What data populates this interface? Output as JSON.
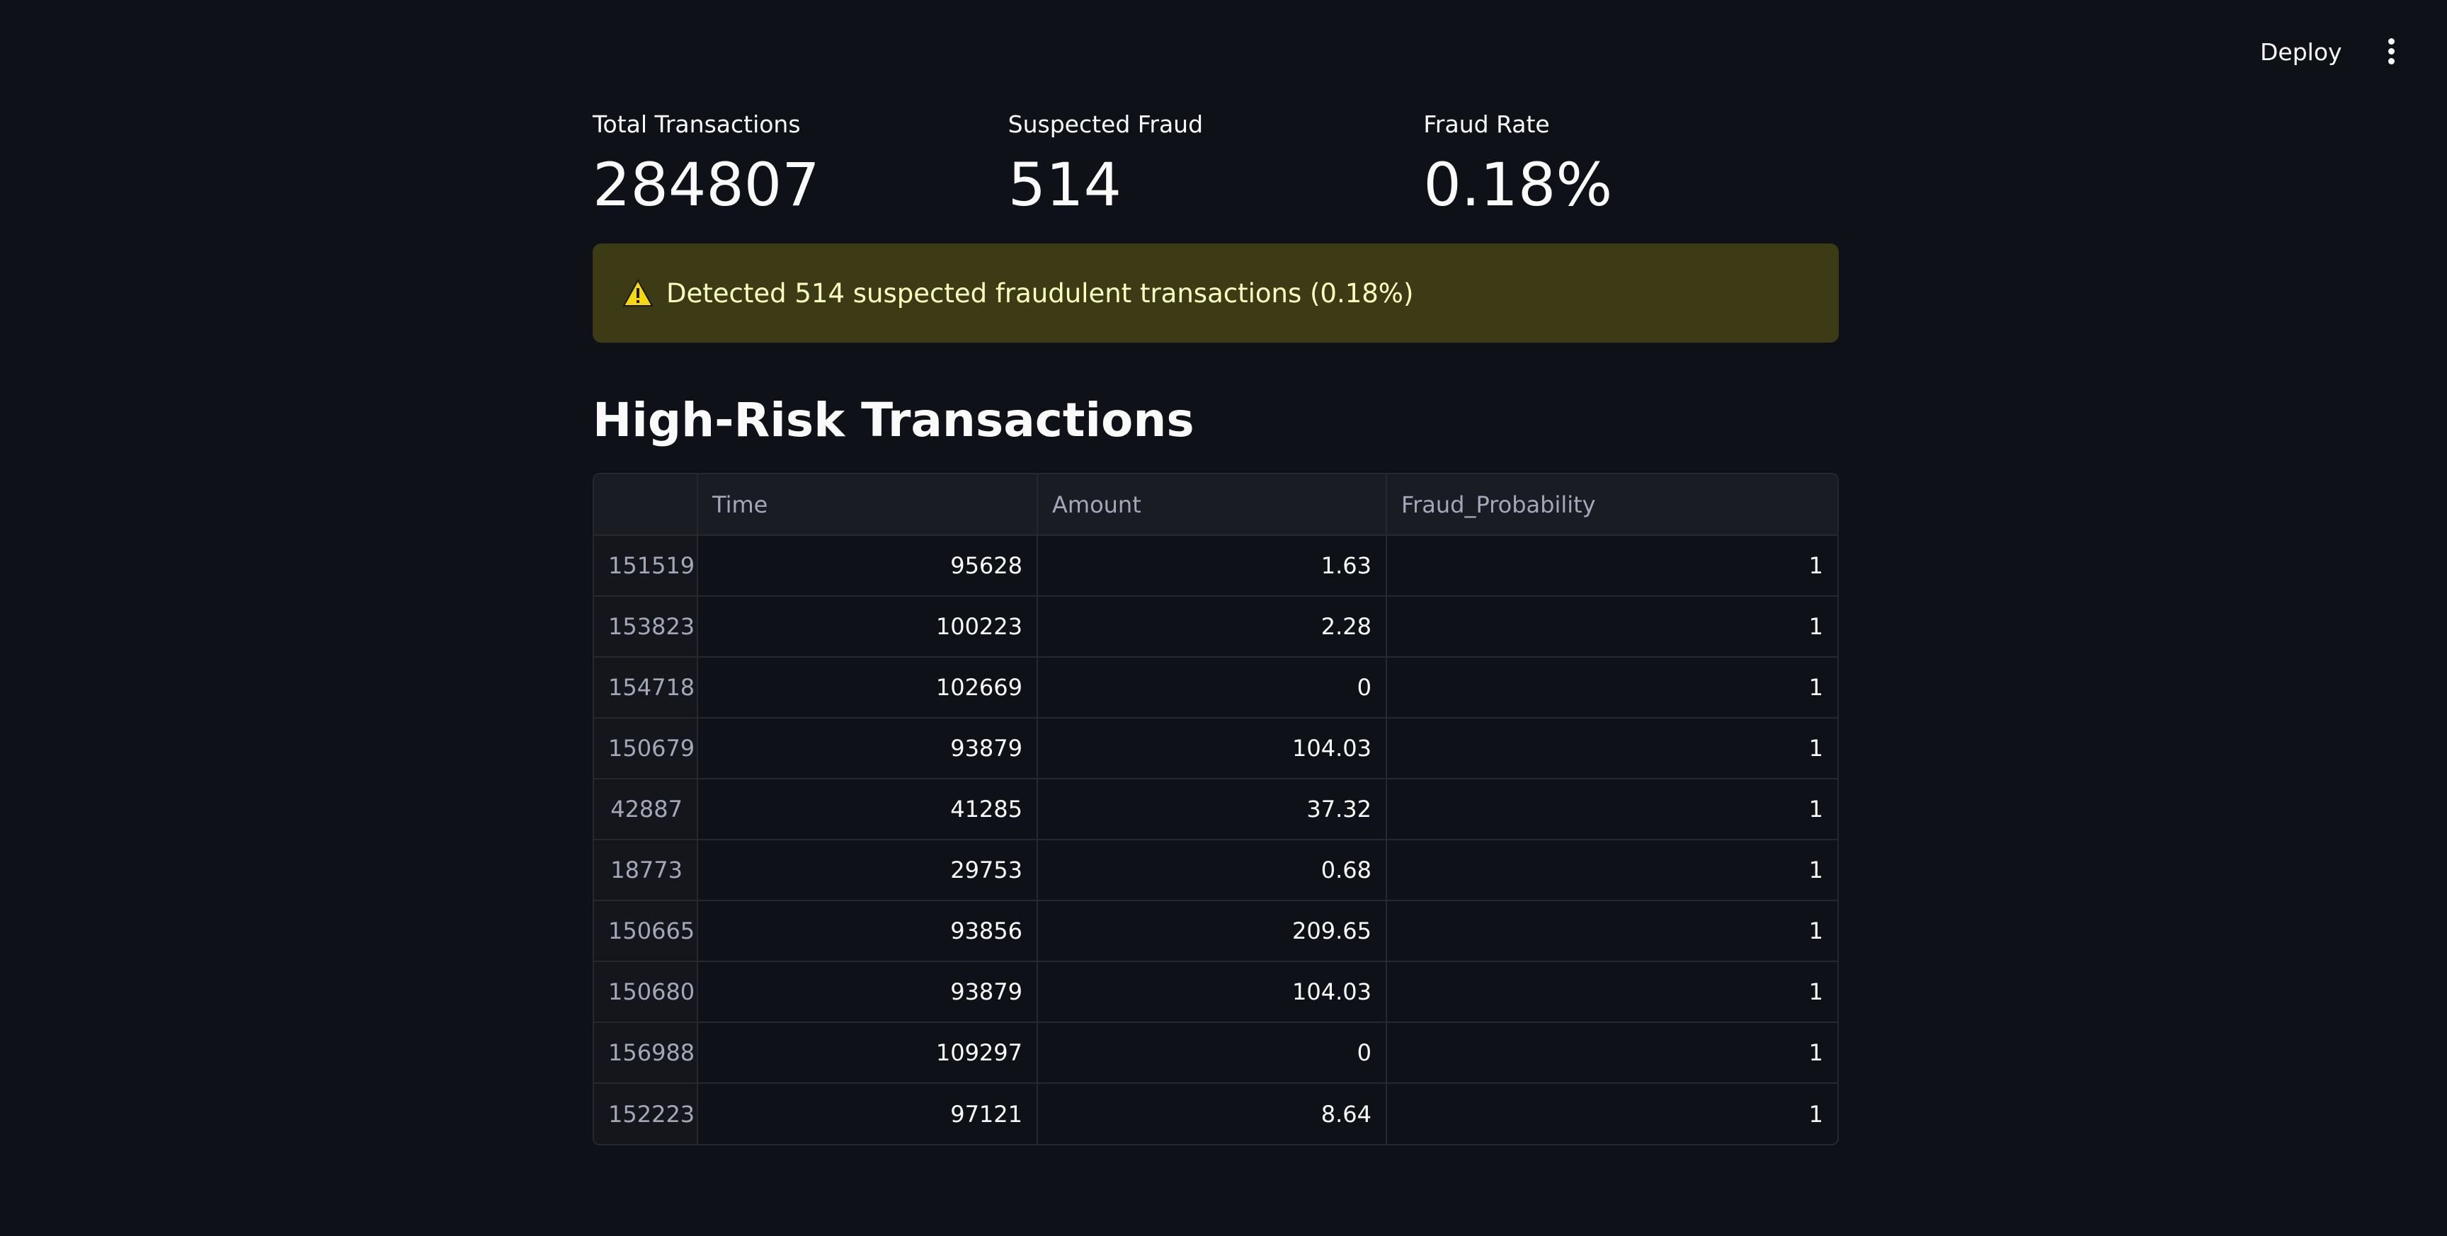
{
  "header": {
    "deploy_label": "Deploy",
    "menu_icon": "more-vertical-icon"
  },
  "metrics": [
    {
      "label": "Total Transactions",
      "value": "284807"
    },
    {
      "label": "Suspected Fraud",
      "value": "514"
    },
    {
      "label": "Fraud Rate",
      "value": "0.18%"
    }
  ],
  "alert": {
    "icon": "warning-icon",
    "text": "Detected 514 suspected fraudulent transactions (0.18%)",
    "background": "#3d3a16",
    "text_color": "#ffffc2"
  },
  "section": {
    "title": "High-Risk Transactions"
  },
  "table": {
    "columns": [
      "",
      "Time",
      "Amount",
      "Fraud_Probability"
    ],
    "rows": [
      [
        "151519",
        "95628",
        "1.63",
        "1"
      ],
      [
        "153823",
        "100223",
        "2.28",
        "1"
      ],
      [
        "154718",
        "102669",
        "0",
        "1"
      ],
      [
        "150679",
        "93879",
        "104.03",
        "1"
      ],
      [
        "42887",
        "41285",
        "37.32",
        "1"
      ],
      [
        "18773",
        "29753",
        "0.68",
        "1"
      ],
      [
        "150665",
        "93856",
        "209.65",
        "1"
      ],
      [
        "150680",
        "93879",
        "104.03",
        "1"
      ],
      [
        "156988",
        "109297",
        "0",
        "1"
      ],
      [
        "152223",
        "97121",
        "8.64",
        "1"
      ]
    ]
  },
  "colors": {
    "background": "#0e1117",
    "text": "#fafafa",
    "muted": "#a3a8b8",
    "border": "#262730"
  }
}
